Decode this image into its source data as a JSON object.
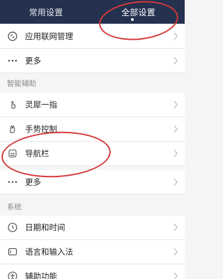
{
  "header": {
    "tabs": [
      {
        "label": "常用设置"
      },
      {
        "label": "全部设置"
      }
    ]
  },
  "sections": {
    "intelligent": "智能辅助",
    "system": "系统"
  },
  "rows": {
    "app_network": "应用联网管理",
    "more_1": "更多",
    "smart_finger": "灵犀一指",
    "gesture_control": "手势控制",
    "navigation_bar": "导航栏",
    "more_2": "更多",
    "date_time": "日期和时间",
    "language_input": "语言和输入法",
    "accessibility": "辅助功能"
  },
  "icons": {
    "app_network": "network-icon",
    "more": "more-icon",
    "smart_finger": "hand-tap-icon",
    "gesture_control": "hand-gesture-icon",
    "navigation_bar": "navigation-bar-icon",
    "date_time": "clock-icon",
    "language_input": "keyboard-icon",
    "accessibility": "accessibility-icon",
    "chevron": "chevron-right-icon"
  },
  "colors": {
    "header_bg": "#24314f",
    "annotation": "#d43a3a"
  }
}
